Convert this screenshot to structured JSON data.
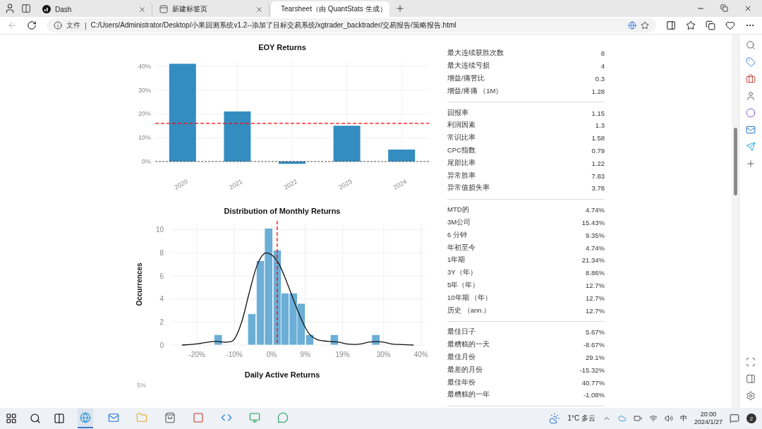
{
  "browser": {
    "tabs": [
      {
        "label": "Dash",
        "selected": false
      },
      {
        "label": "新建标签页",
        "selected": false
      },
      {
        "label": "Tearsheet（由 QuantStats 生成）",
        "selected": true
      }
    ],
    "address": {
      "prefix": "文件",
      "separator": "|",
      "url": "C:/Users/Administrator/Desktop/小果回测系统v1.2--添加了目标交易系统/xgtrader_backtrader/交易报告/策略报告.html"
    }
  },
  "charts": [
    {
      "chart_data": {
        "type": "bar",
        "title": "EOY Returns",
        "categories": [
          "2020",
          "2021",
          "2022",
          "2023",
          "2024"
        ],
        "series": [
          {
            "color": "#348dc1",
            "values": [
              41,
              21,
              -1,
              15,
              5
            ]
          }
        ],
        "ylim": [
          -3,
          42
        ],
        "yticks": [
          {
            "value": 0,
            "label": "0%"
          },
          {
            "value": 10,
            "label": "10%"
          },
          {
            "value": 20,
            "label": "20%"
          },
          {
            "value": 30,
            "label": "30%"
          },
          {
            "value": 40,
            "label": "40%"
          }
        ],
        "grid": true,
        "ref_lines": [
          {
            "axis": "y",
            "value": 16,
            "color": "#ff0000"
          },
          {
            "axis": "y",
            "value": 0,
            "color": "#333333"
          }
        ]
      }
    },
    {
      "chart_data": {
        "type": "bar",
        "title": "Distribution of Monthly Returns",
        "ylabel": "Occurrences",
        "x": [
          -14.3,
          -5.3,
          -3.0,
          -0.8,
          1.5,
          3.6,
          5.8,
          7.9,
          10.2,
          16.8,
          27.9
        ],
        "series": [
          {
            "type": "bar",
            "color": "#6baed6",
            "values": [
              0.9,
              2.7,
              7.3,
              10.1,
              8.2,
              4.5,
              4.5,
              3.6,
              0.9,
              0.9,
              0.9
            ]
          },
          {
            "type": "line",
            "color": "#111111",
            "x": [
              -24,
              -20,
              -16,
              -14,
              -12,
              -10,
              -8,
              -6,
              -4,
              -2,
              0,
              2,
              4,
              6,
              8,
              10,
              12,
              14,
              16,
              18,
              20,
              22,
              24,
              26,
              28,
              30,
              32,
              34,
              38
            ],
            "values": [
              0,
              0.1,
              0.3,
              0.3,
              0.25,
              0.5,
              2,
              4.5,
              6.8,
              7.9,
              7.8,
              7,
              5.5,
              3.8,
              2.2,
              1,
              0.5,
              0.35,
              0.3,
              0.25,
              0.1,
              0.05,
              0.1,
              0.25,
              0.3,
              0.25,
              0.1,
              0.05,
              0
            ]
          }
        ],
        "xlim": [
          -27,
          41
        ],
        "ylim": [
          0,
          10.5
        ],
        "xticks": [
          {
            "value": -20,
            "label": "-20%"
          },
          {
            "value": -10,
            "label": "-10%"
          },
          {
            "value": 0,
            "label": "0%"
          },
          {
            "value": 9,
            "label": "9%"
          },
          {
            "value": 19,
            "label": "19%"
          },
          {
            "value": 30,
            "label": "30%"
          },
          {
            "value": 40,
            "label": "40%"
          }
        ],
        "yticks": [
          0,
          2,
          4,
          6,
          8,
          10
        ],
        "grid": true,
        "ref_lines": [
          {
            "axis": "x",
            "value": 1.5,
            "color": "#ff0000"
          }
        ]
      }
    }
  ],
  "next_chart": {
    "title": "Daily Active Returns",
    "tick": "5%"
  },
  "metrics": [
    [
      {
        "label": "最大连续获胜次数",
        "value": "8"
      },
      {
        "label": "最大连续亏损",
        "value": "4"
      },
      {
        "label": "增益/痛苦比",
        "value": "0.3"
      },
      {
        "label": "增益/疼痛 （1M）",
        "value": "1.28"
      }
    ],
    [
      {
        "label": "回报率",
        "value": "1.15"
      },
      {
        "label": "利润因素",
        "value": "1.3"
      },
      {
        "label": "常识比率",
        "value": "1.58"
      },
      {
        "label": "CPC指数",
        "value": "0.79"
      },
      {
        "label": "尾部比率",
        "value": "1.22"
      },
      {
        "label": "异常胜率",
        "value": "7.83"
      },
      {
        "label": "异常值损失率",
        "value": "3.78"
      }
    ],
    [
      {
        "label": "MTD的",
        "value": "4.74%"
      },
      {
        "label": "3M公司",
        "value": "15.43%"
      },
      {
        "label": "6 分钟",
        "value": "9.35%"
      },
      {
        "label": "年初至今",
        "value": "4.74%"
      },
      {
        "label": "1年期",
        "value": "21.34%"
      },
      {
        "label": "3Y（年）",
        "value": "8.86%"
      },
      {
        "label": "5年（年）",
        "value": "12.7%"
      },
      {
        "label": "10年期 （年）",
        "value": "12.7%"
      },
      {
        "label": "历史 （ann.）",
        "value": "12.7%"
      }
    ],
    [
      {
        "label": "最佳日子",
        "value": "5.67%"
      },
      {
        "label": "最糟糕的一天",
        "value": "-8.67%"
      },
      {
        "label": "最佳月份",
        "value": "29.1%"
      },
      {
        "label": "最差的月份",
        "value": "-15.32%"
      },
      {
        "label": "最佳年份",
        "value": "40.77%"
      },
      {
        "label": "最糟糕的一年",
        "value": "-1.08%"
      }
    ]
  ],
  "taskbar": {
    "weather": "1°C 多云",
    "ime": "中",
    "time": "20:00",
    "date": "2024/1/27",
    "notifications": "2"
  }
}
